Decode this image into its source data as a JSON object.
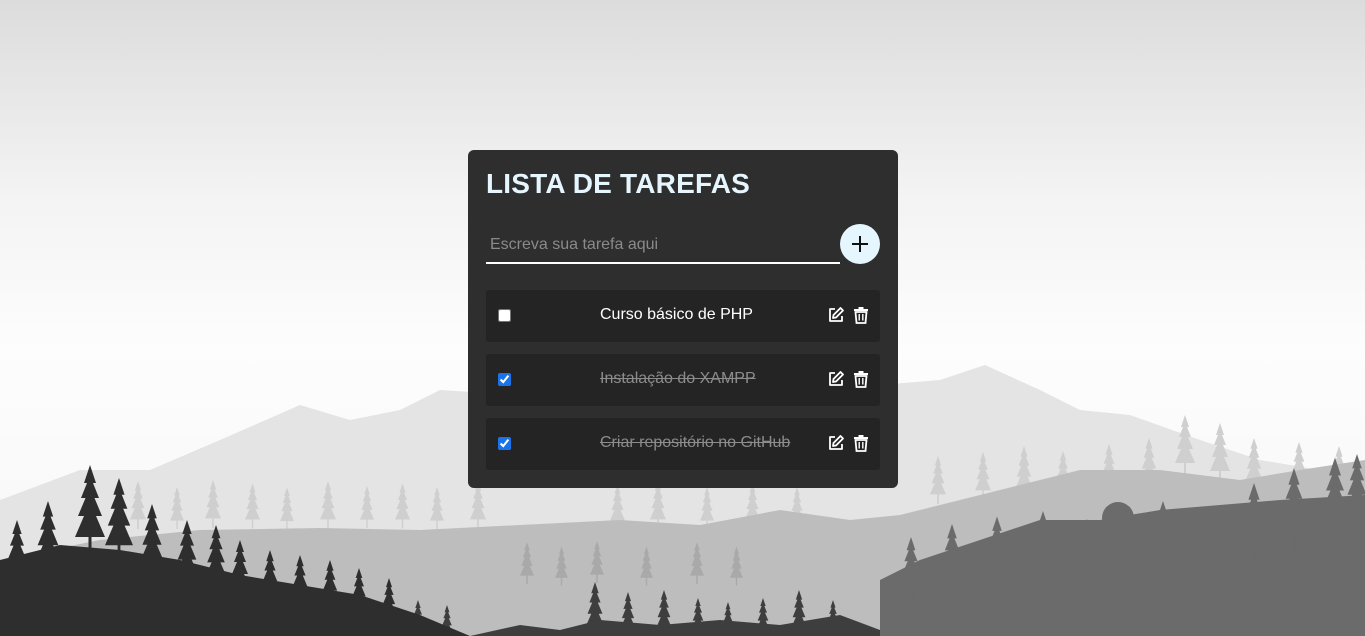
{
  "app": {
    "title": "LISTA DE TAREFAS"
  },
  "input": {
    "placeholder": "Escreva sua tarefa aqui",
    "value": ""
  },
  "add_button_icon": "plus-icon",
  "tasks": [
    {
      "text": "Curso básico de PHP",
      "done": false
    },
    {
      "text": "Instalação do XAMPP",
      "done": true
    },
    {
      "text": "Criar repositório no GitHub",
      "done": true
    }
  ],
  "task_action_icons": [
    "edit-icon",
    "trash-icon"
  ],
  "colors": {
    "card_background": "#2e2e2e",
    "task_background": "#242424",
    "title": "#e6f6ff",
    "add_button": "#e6f6ff",
    "done_text": "#8c8c8c",
    "checkbox_accent": "#1a73e8"
  }
}
